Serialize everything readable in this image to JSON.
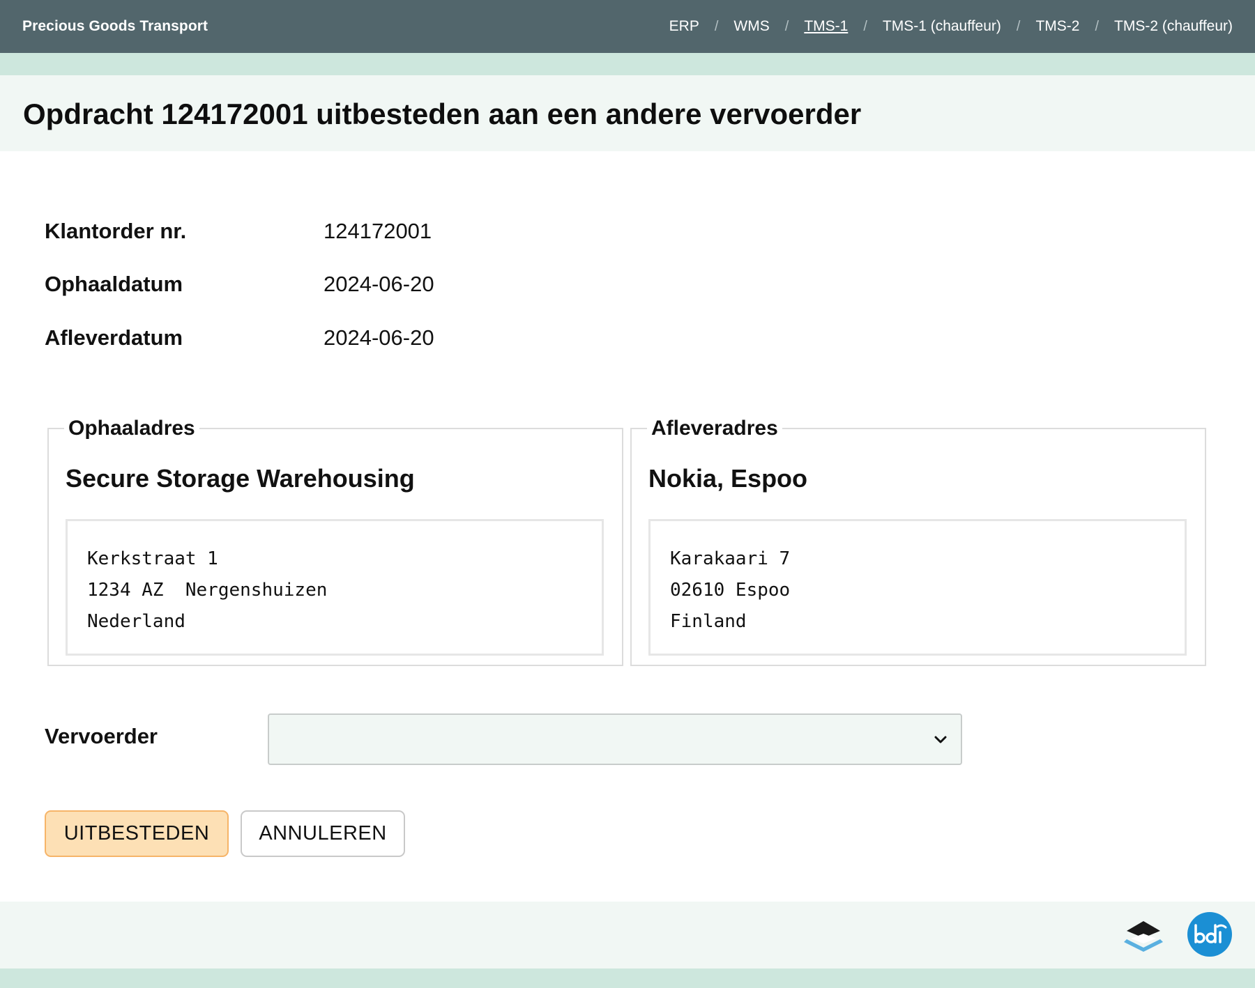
{
  "header": {
    "brand": "Precious Goods Transport",
    "nav": [
      {
        "label": "ERP"
      },
      {
        "label": "WMS"
      },
      {
        "label": "TMS-1",
        "active": true
      },
      {
        "label": "TMS-1 (chauffeur)"
      },
      {
        "label": "TMS-2"
      },
      {
        "label": "TMS-2 (chauffeur)"
      }
    ],
    "separator": "/"
  },
  "page": {
    "title": "Opdracht 124172001 uitbesteden aan een andere vervoerder"
  },
  "details": {
    "order_label": "Klantorder nr.",
    "order_value": "124172001",
    "pickup_date_label": "Ophaaldatum",
    "pickup_date_value": "2024-06-20",
    "delivery_date_label": "Afleverdatum",
    "delivery_date_value": "2024-06-20"
  },
  "pickup": {
    "legend": "Ophaaladres",
    "name": "Secure Storage Warehousing",
    "lines": [
      "Kerkstraat 1",
      "1234 AZ  Nergenshuizen",
      "Nederland"
    ]
  },
  "delivery": {
    "legend": "Afleveradres",
    "name": "Nokia, Espoo",
    "lines": [
      "Karakaari 7",
      "02610 Espoo",
      "Finland"
    ]
  },
  "carrier": {
    "label": "Vervoerder",
    "selected": ""
  },
  "actions": {
    "submit_label": "UITBESTEDEN",
    "cancel_label": "ANNULEREN"
  },
  "colors": {
    "navbar": "#52666c",
    "page_bg": "#cde7dd",
    "band_bg": "#f1f7f4",
    "primary_button": "#fde0b5",
    "primary_border": "#f6b468",
    "bdi_blue": "#1b8fd4"
  },
  "footer": {
    "icons": [
      "layers-logo-icon",
      "bdi-logo-icon"
    ]
  }
}
